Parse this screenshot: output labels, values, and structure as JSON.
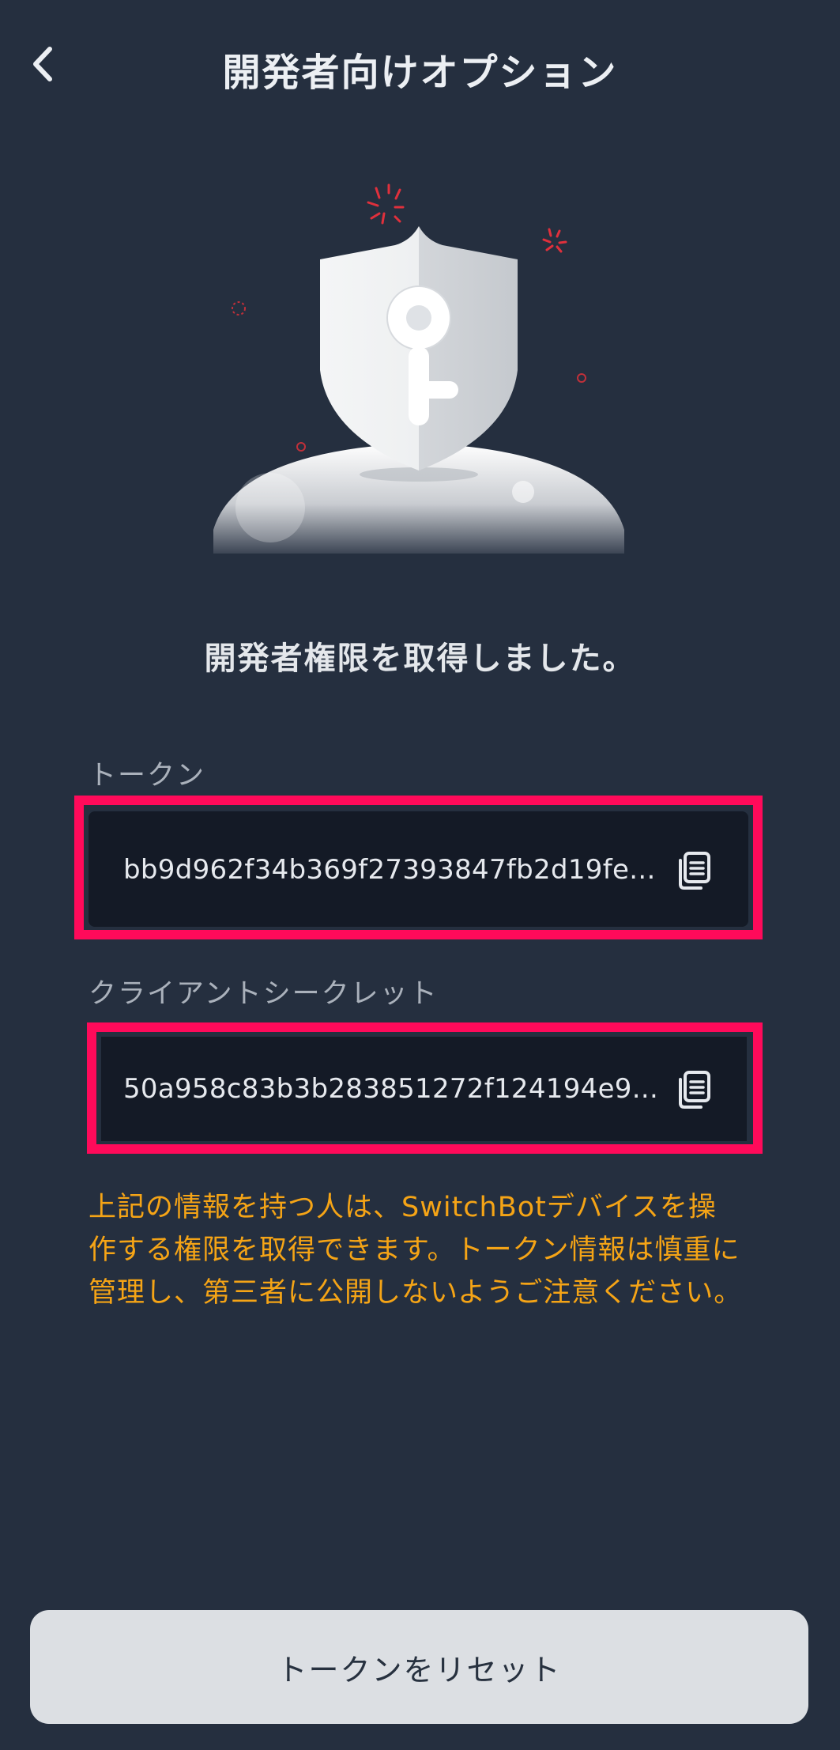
{
  "header": {
    "title": "開発者向けオプション",
    "back_icon": "chevron-left-icon"
  },
  "illustration": {
    "icon": "shield-key-icon"
  },
  "status_message": "開発者権限を取得しました。",
  "token": {
    "label": "トークン",
    "value": "bb9d962f34b369f27393847fb2d19fe...",
    "copy_icon": "copy-icon"
  },
  "client_secret": {
    "label": "クライアントシークレット",
    "value": "50a958c83b3b283851272f124194e9...",
    "copy_icon": "copy-icon"
  },
  "warning": "上記の情報を持つ人は、SwitchBotデバイスを操作する権限を取得できます。トークン情報は慎重に管理し、第三者に公開しないようご注意ください。",
  "reset_button": {
    "label": "トークンをリセット"
  },
  "colors": {
    "background": "#252f3f",
    "field_background": "#141a26",
    "highlight": "#ff0a5a",
    "warning": "#f5a416",
    "button_background": "#dcdfe3"
  }
}
